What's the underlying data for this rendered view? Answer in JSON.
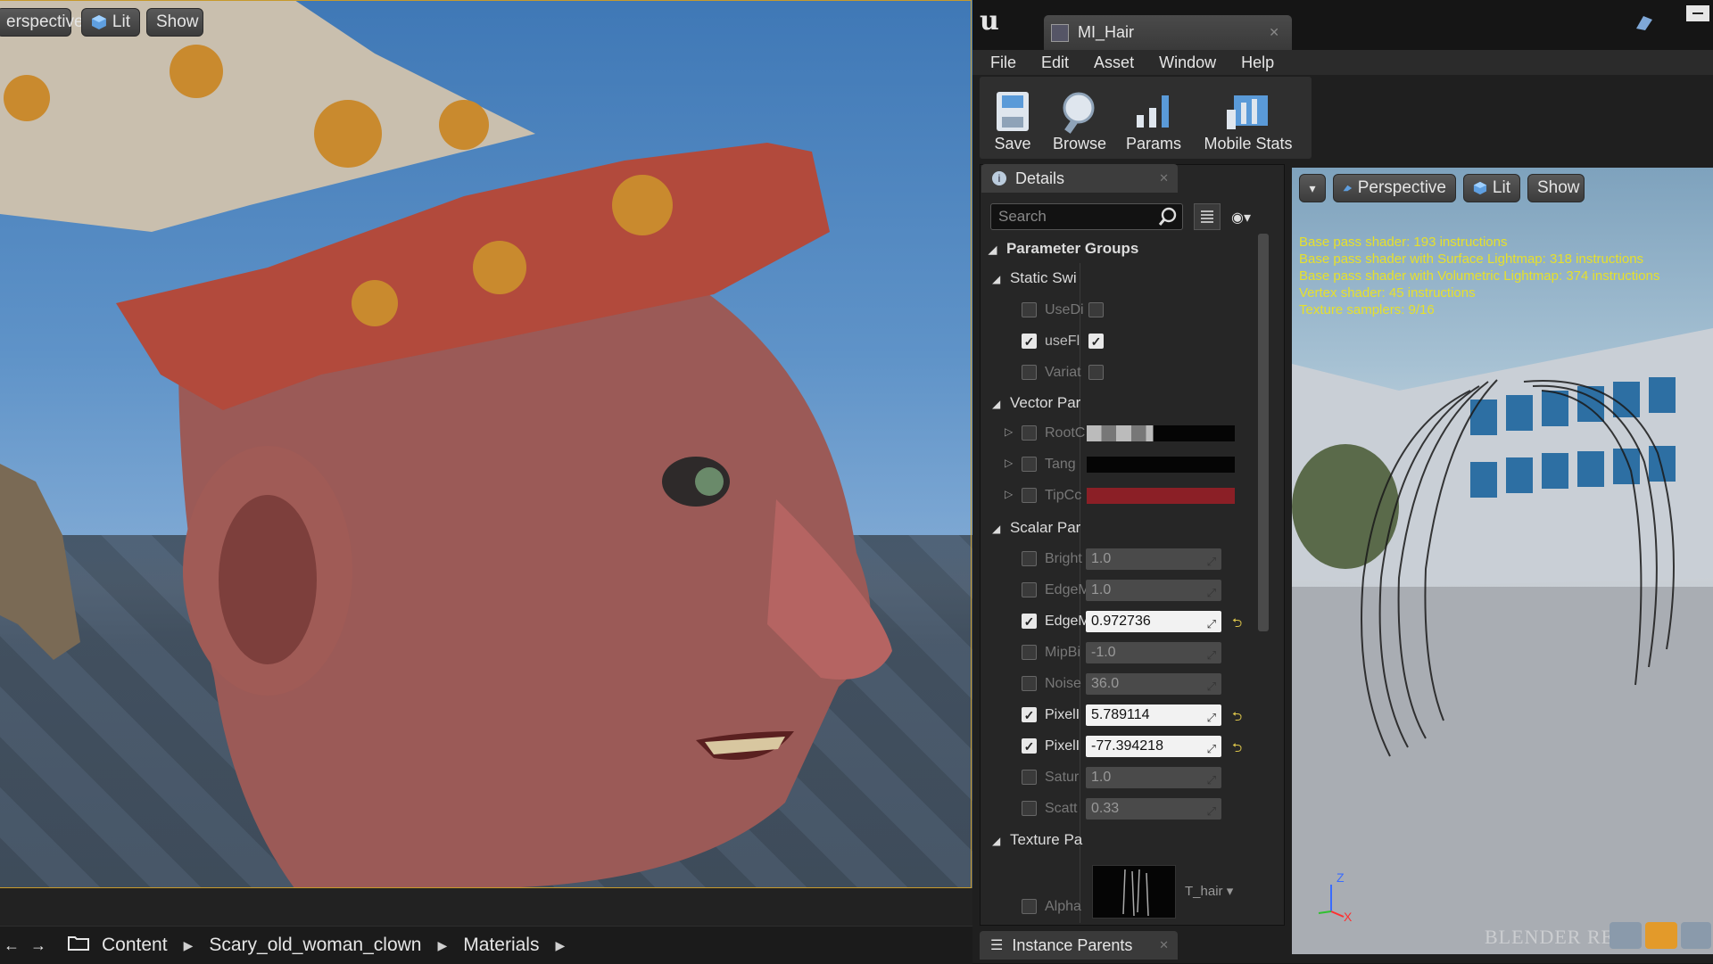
{
  "colors": {
    "accent": "#c79a2c",
    "stats_text": "#e6e02c",
    "tip_color": "#8b1f26"
  },
  "left_viewport": {
    "perspective_label": "erspective",
    "lit_label": "Lit",
    "show_label": "Show"
  },
  "content_path": {
    "items": [
      "Content",
      "Scary_old_woman_clown",
      "Materials"
    ]
  },
  "editor": {
    "tab_title": "MI_Hair",
    "menu": [
      "File",
      "Edit",
      "Asset",
      "Window",
      "Help"
    ],
    "toolbar": {
      "save": "Save",
      "browse": "Browse",
      "params": "Params",
      "mobile_stats": "Mobile Stats"
    }
  },
  "details": {
    "tab_label": "Details",
    "search_placeholder": "Search",
    "parameter_groups": "Parameter Groups",
    "static_switch": {
      "header": "Static Swi",
      "rows": [
        {
          "label": "UseDi",
          "checked": false,
          "value_checked": false
        },
        {
          "label": "useFl",
          "checked": true,
          "value_checked": true
        },
        {
          "label": "Variat",
          "checked": false,
          "value_checked": false
        }
      ]
    },
    "vector": {
      "header": "Vector Par",
      "rows": [
        {
          "label": "RootC"
        },
        {
          "label": "Tang"
        },
        {
          "label": "TipCc"
        }
      ]
    },
    "scalar": {
      "header": "Scalar Par",
      "rows": [
        {
          "label": "Bright",
          "value": "1.0",
          "checked": false
        },
        {
          "label": "EdgeM",
          "value": "1.0",
          "checked": false
        },
        {
          "label": "EdgeM",
          "value": "0.972736",
          "checked": true
        },
        {
          "label": "MipBi",
          "value": "-1.0",
          "checked": false
        },
        {
          "label": "Noise",
          "value": "36.0",
          "checked": false
        },
        {
          "label": "PixelI",
          "value": "5.789114",
          "checked": true
        },
        {
          "label": "PixelI",
          "value": "-77.394218",
          "checked": true
        },
        {
          "label": "Satur",
          "value": "1.0",
          "checked": false
        },
        {
          "label": "Scatt",
          "value": "0.33",
          "checked": false
        }
      ]
    },
    "texture": {
      "header": "Texture Pa",
      "alpha_label": "Alpha",
      "texture_name": "T_hair"
    }
  },
  "preview": {
    "perspective_label": "Perspective",
    "lit_label": "Lit",
    "show_label": "Show",
    "stats": [
      "Base pass shader: 193 instructions",
      "Base pass shader with Surface Lightmap: 318 instructions",
      "Base pass shader with Volumetric Lightmap: 374 instructions",
      "Vertex shader: 45 instructions",
      "Texture samplers: 9/16"
    ],
    "axis_z": "Z",
    "axis_x": "X",
    "watermark": "BLENDER RE"
  },
  "instance_parents": {
    "label": "Instance Parents"
  }
}
